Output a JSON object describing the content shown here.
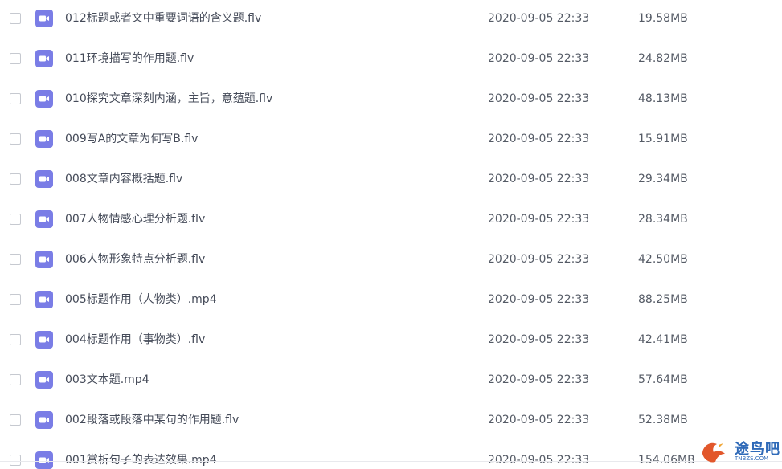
{
  "files": [
    {
      "name": "012标题或者文中重要词语的含义题.flv",
      "date": "2020-09-05 22:33",
      "size": "19.58MB"
    },
    {
      "name": "011环境描写的作用题.flv",
      "date": "2020-09-05 22:33",
      "size": "24.82MB"
    },
    {
      "name": "010探究文章深刻内涵，主旨，意蕴题.flv",
      "date": "2020-09-05 22:33",
      "size": "48.13MB"
    },
    {
      "name": "009写A的文章为何写B.flv",
      "date": "2020-09-05 22:33",
      "size": "15.91MB"
    },
    {
      "name": "008文章内容概括题.flv",
      "date": "2020-09-05 22:33",
      "size": "29.34MB"
    },
    {
      "name": "007人物情感心理分析题.flv",
      "date": "2020-09-05 22:33",
      "size": "28.34MB"
    },
    {
      "name": "006人物形象特点分析题.flv",
      "date": "2020-09-05 22:33",
      "size": "42.50MB"
    },
    {
      "name": "005标题作用（人物类）.mp4",
      "date": "2020-09-05 22:33",
      "size": "88.25MB"
    },
    {
      "name": "004标题作用（事物类）.flv",
      "date": "2020-09-05 22:33",
      "size": "42.41MB"
    },
    {
      "name": "003文本题.mp4",
      "date": "2020-09-05 22:33",
      "size": "57.64MB"
    },
    {
      "name": "002段落或段落中某句的作用题.flv",
      "date": "2020-09-05 22:33",
      "size": "52.38MB"
    },
    {
      "name": "001赏析句子的表达效果.mp4",
      "date": "2020-09-05 22:33",
      "size": "154.06MB"
    }
  ],
  "watermark": {
    "text": "途鸟吧",
    "subtext": "TNBZS.COM"
  },
  "colors": {
    "video_icon": "#7a7de6",
    "text": "#454b59",
    "checkbox_border": "#c6c9d0",
    "watermark": "#2f6ab8"
  }
}
